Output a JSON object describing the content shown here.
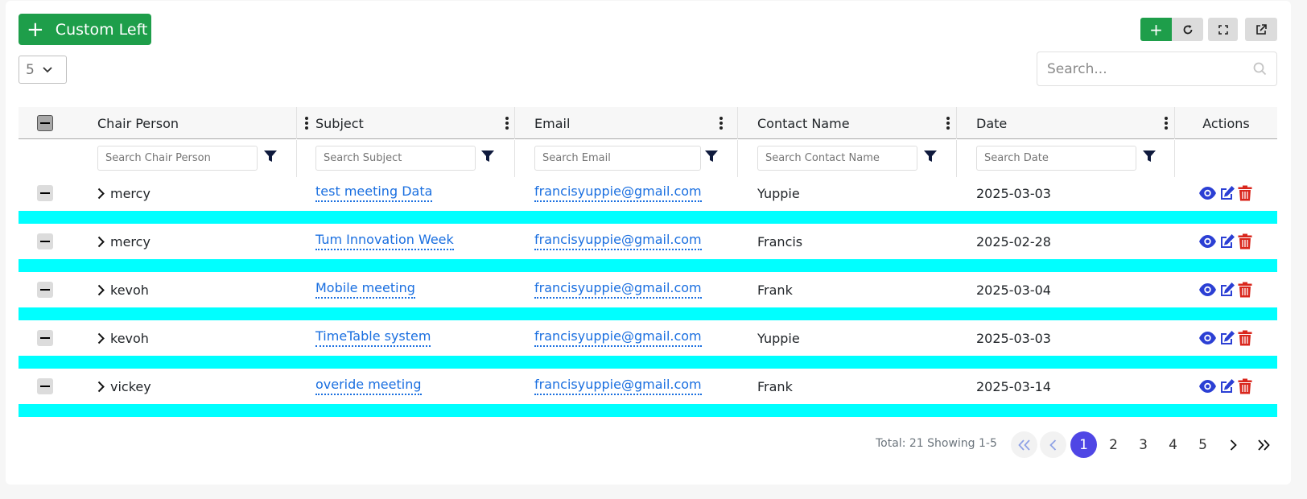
{
  "toolbar": {
    "custom_left_label": "Custom Left",
    "page_size": "5",
    "search_placeholder": "Search..."
  },
  "columns": {
    "chair_person": "Chair Person",
    "subject": "Subject",
    "email": "Email",
    "contact_name": "Contact Name",
    "date": "Date",
    "actions": "Actions"
  },
  "filters": {
    "chair_person": "Search Chair Person",
    "subject": "Search Subject",
    "email": "Search Email",
    "contact_name": "Search Contact Name",
    "date": "Search Date"
  },
  "rows": [
    {
      "chair_person": "mercy",
      "subject": "test meeting Data",
      "email": "francisyuppie@gmail.com",
      "contact_name": "Yuppie",
      "date": "2025-03-03"
    },
    {
      "chair_person": "mercy",
      "subject": "Tum Innovation Week",
      "email": "francisyuppie@gmail.com",
      "contact_name": "Francis",
      "date": "2025-02-28"
    },
    {
      "chair_person": "kevoh",
      "subject": "Mobile meeting",
      "email": "francisyuppie@gmail.com",
      "contact_name": "Frank",
      "date": "2025-03-04"
    },
    {
      "chair_person": "kevoh",
      "subject": "TimeTable system",
      "email": "francisyuppie@gmail.com",
      "contact_name": "Yuppie",
      "date": "2025-03-03"
    },
    {
      "chair_person": "vickey",
      "subject": "overide meeting",
      "email": "francisyuppie@gmail.com",
      "contact_name": "Frank",
      "date": "2025-03-14"
    }
  ],
  "pagination": {
    "total_text": "Total: 21  Showing 1-5",
    "pages": [
      "1",
      "2",
      "3",
      "4",
      "5"
    ],
    "current_page": "1"
  },
  "colors": {
    "accent_green": "#1e9e4a",
    "row_separator_cyan": "#00ffff",
    "link_blue": "#1a6fe0",
    "active_page": "#4f46e5",
    "delete_red": "#d9261c"
  }
}
